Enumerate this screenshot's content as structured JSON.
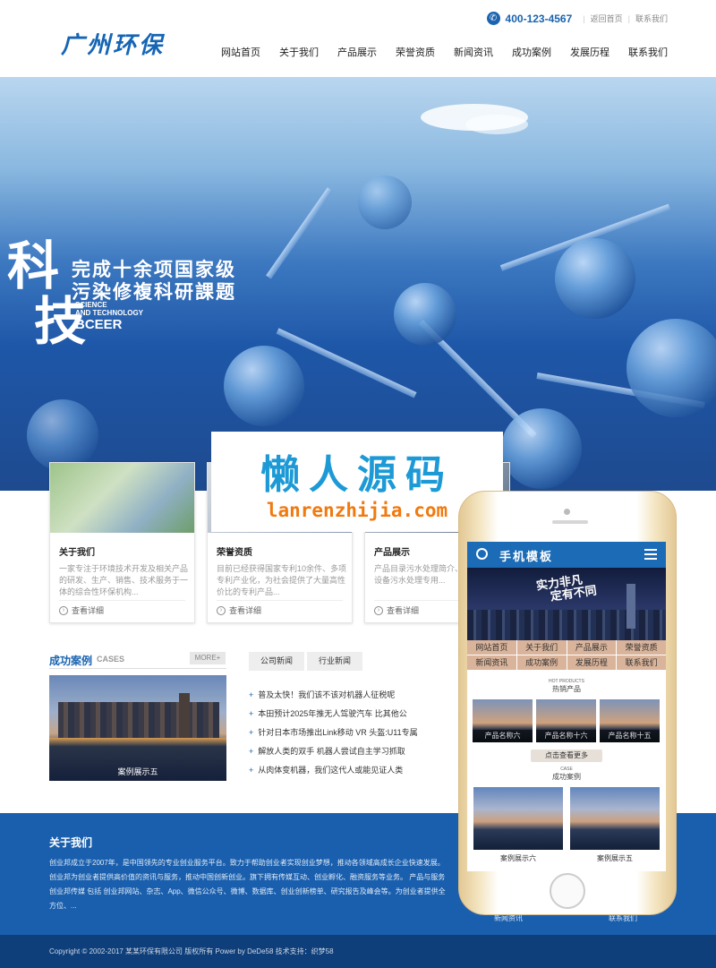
{
  "header": {
    "logo": "广州环保",
    "phone": "400-123-4567",
    "top_links": [
      "返回首页",
      "联系我们"
    ],
    "nav": [
      "网站首页",
      "关于我们",
      "产品展示",
      "荣誉资质",
      "新闻资讯",
      "成功案例",
      "发展历程",
      "联系我们"
    ]
  },
  "banner": {
    "big": [
      "科",
      "技"
    ],
    "line1": "完成十余项国家级",
    "line2": "污染修複科研課题",
    "en1": "SCIENCE",
    "en2": "AND TECHNOLOGY",
    "en3": "BCEER"
  },
  "watermark": {
    "cn": "懒人源码",
    "en": "lanrenzhijia.com"
  },
  "cards": [
    {
      "title": "关于我们",
      "desc": "一家专注于环境技术开发及相关产品的研发、生产、销售、技术服务于一体的综合性环保机构...",
      "more": "查看详细"
    },
    {
      "title": "荣誉资质",
      "desc": "目前已经获得国家专利10余件、多项专利产业化，为社会提供了大量高性价比的专利产品...",
      "more": "查看详细"
    },
    {
      "title": "产品展示",
      "desc": "产品目录污水处理简介、设备工艺与设备污水处理专用...",
      "more": "查看详细"
    }
  ],
  "cases": {
    "title": "成功案例",
    "sub": "CASES",
    "more": "MORE+",
    "caption": "案例展示五"
  },
  "news": {
    "tabs": [
      "公司新闻",
      "行业新闻"
    ],
    "items": [
      "普及太快！我们该不该对机器人征税呢",
      "本田预计2025年推无人驾驶汽车 比其他公",
      "针对日本市场推出Link移动 VR 头盔:U11专属",
      "解放人类的双手 机器人尝试自主学习抓取",
      "从肉体变机器，我们这代人或能见证人类"
    ]
  },
  "footer": {
    "title": "关于我们",
    "text": "创业邦成立于2007年，是中国领先的专业创业服务平台。致力于帮助创业者实现创业梦想，推动各领域高成长企业快速发展。 创业邦为创业者提供高价值的资讯与服务，推动中国创新创业。旗下拥有传媒互动、创业孵化、融资服务等业务。 产品与服务 创业邦传媒 包括 创业邦网站、杂志、App、微信公众号、微博、数据库、创业创新榜单、研究报告及峰会等。为创业者提供全方位、...",
    "link1": "新闻资讯",
    "link2": "联系我们"
  },
  "copyright": "Copyright © 2002-2017 某某环保有限公司 版权所有 Power by DeDe58 技术支持：织梦58",
  "mobile": {
    "title": "手机模板",
    "slogan1": "实力非凡",
    "slogan2": "定有不同",
    "nav": [
      "网站首页",
      "关于我们",
      "产品展示",
      "荣誉资质",
      "新闻资讯",
      "成功案例",
      "发展历程",
      "联系我们"
    ],
    "hot_en": "HOT PRODUCTS",
    "hot_cn": "热销产品",
    "products": [
      "产品名称六",
      "产品名称十六",
      "产品名称十五"
    ],
    "btn": "点击查看更多",
    "case_en": "CASE",
    "case_cn": "成功案例",
    "cases": [
      "案例展示六",
      "案例展示五"
    ]
  }
}
